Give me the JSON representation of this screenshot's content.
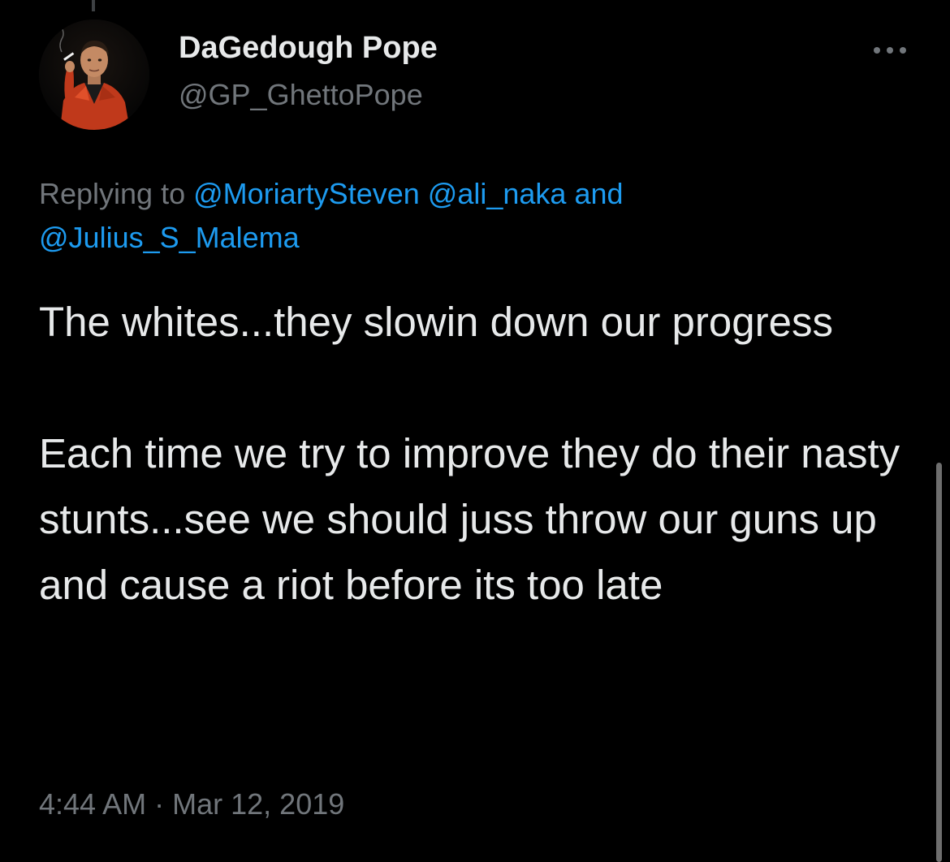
{
  "tweet": {
    "author": {
      "display_name": "DaGedough Pope",
      "handle": "@GP_GhettoPope",
      "avatar_icon": "profile-photo-man-red-suit-cigarette"
    },
    "more_icon": "more-dots-icon",
    "reply_context": {
      "prefix": "Replying to",
      "mention_1": "@MoriartySteven",
      "mention_2": "@ali_naka",
      "joiner": "and",
      "mention_3": "@Julius_S_Malema"
    },
    "text": {
      "paragraph_1": "The whites...they slowin down our progress",
      "paragraph_2": "Each time we try to improve they do their nasty stunts...see we should juss throw our guns up and cause a riot before its too late"
    },
    "meta": {
      "time": "4:44 AM",
      "separator": "·",
      "date": "Mar 12, 2019"
    }
  },
  "colors": {
    "background": "#000000",
    "text_primary": "#e7e9ea",
    "text_secondary": "#71767b",
    "accent_link": "#1d9bf0"
  }
}
